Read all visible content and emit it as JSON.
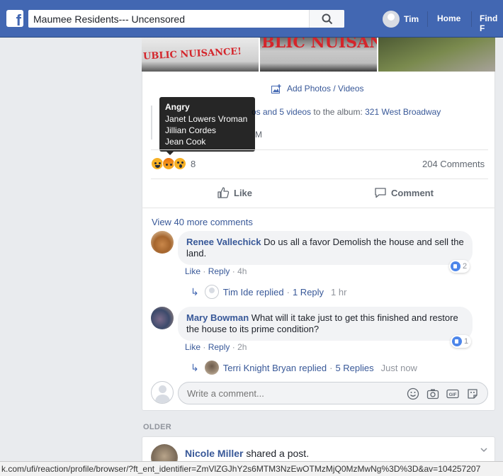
{
  "topbar": {
    "search_value": "Maumee Residents--- Uncensored",
    "profile_name": "Tim",
    "nav_home": "Home",
    "nav_find": "Find F"
  },
  "photos": {
    "graffiti_left": "UBLIC NUISANCE!",
    "graffiti_middle": "BLIC NUISANC"
  },
  "post": {
    "add_photos_label": "Add Photos / Videos",
    "album_prefix": "os and 5 videos",
    "album_to": "to the album:",
    "album_name": "321 West Broadway",
    "album_time": "M",
    "reaction_count": "8",
    "comments_count": "204 Comments",
    "like_label": "Like",
    "comment_label": "Comment",
    "view_more": "View 40 more comments"
  },
  "tooltip": {
    "title": "Angry",
    "names": [
      "Janet Lowers Vroman",
      "Jillian Cordes",
      "Jean Cook"
    ]
  },
  "comments": [
    {
      "name": "Renee Vallechick",
      "text": "Do us all a favor Demolish the house and sell the land.",
      "like": "Like",
      "reply": "Reply",
      "time": "4h",
      "likes": "2",
      "reply_summary": {
        "name": "Tim Ide",
        "replied": "replied",
        "count": "1 Reply",
        "time": "1 hr"
      }
    },
    {
      "name": "Mary Bowman",
      "text": "What will it take just to get this finished and restore the house to its prime condition?",
      "like": "Like",
      "reply": "Reply",
      "time": "2h",
      "likes": "1",
      "reply_summary": {
        "name": "Terri Knight Bryan",
        "replied": "replied",
        "count": "5 Replies",
        "time": "Just now"
      }
    }
  ],
  "write_comment": {
    "placeholder": "Write a comment..."
  },
  "older_label": "OLDER",
  "next_post": {
    "author": "Nicole Miller",
    "action": "shared a post."
  },
  "statusbar": {
    "url": "k.com/ufi/reaction/profile/browser/?ft_ent_identifier=ZmVlZGJhY2s6MTM3NzEwOTMzMjQ0MzMwNg%3D%3D&av=104257207"
  },
  "colors": {
    "brand": "#4267b2",
    "link": "#385898",
    "background": "#e9ebee"
  }
}
